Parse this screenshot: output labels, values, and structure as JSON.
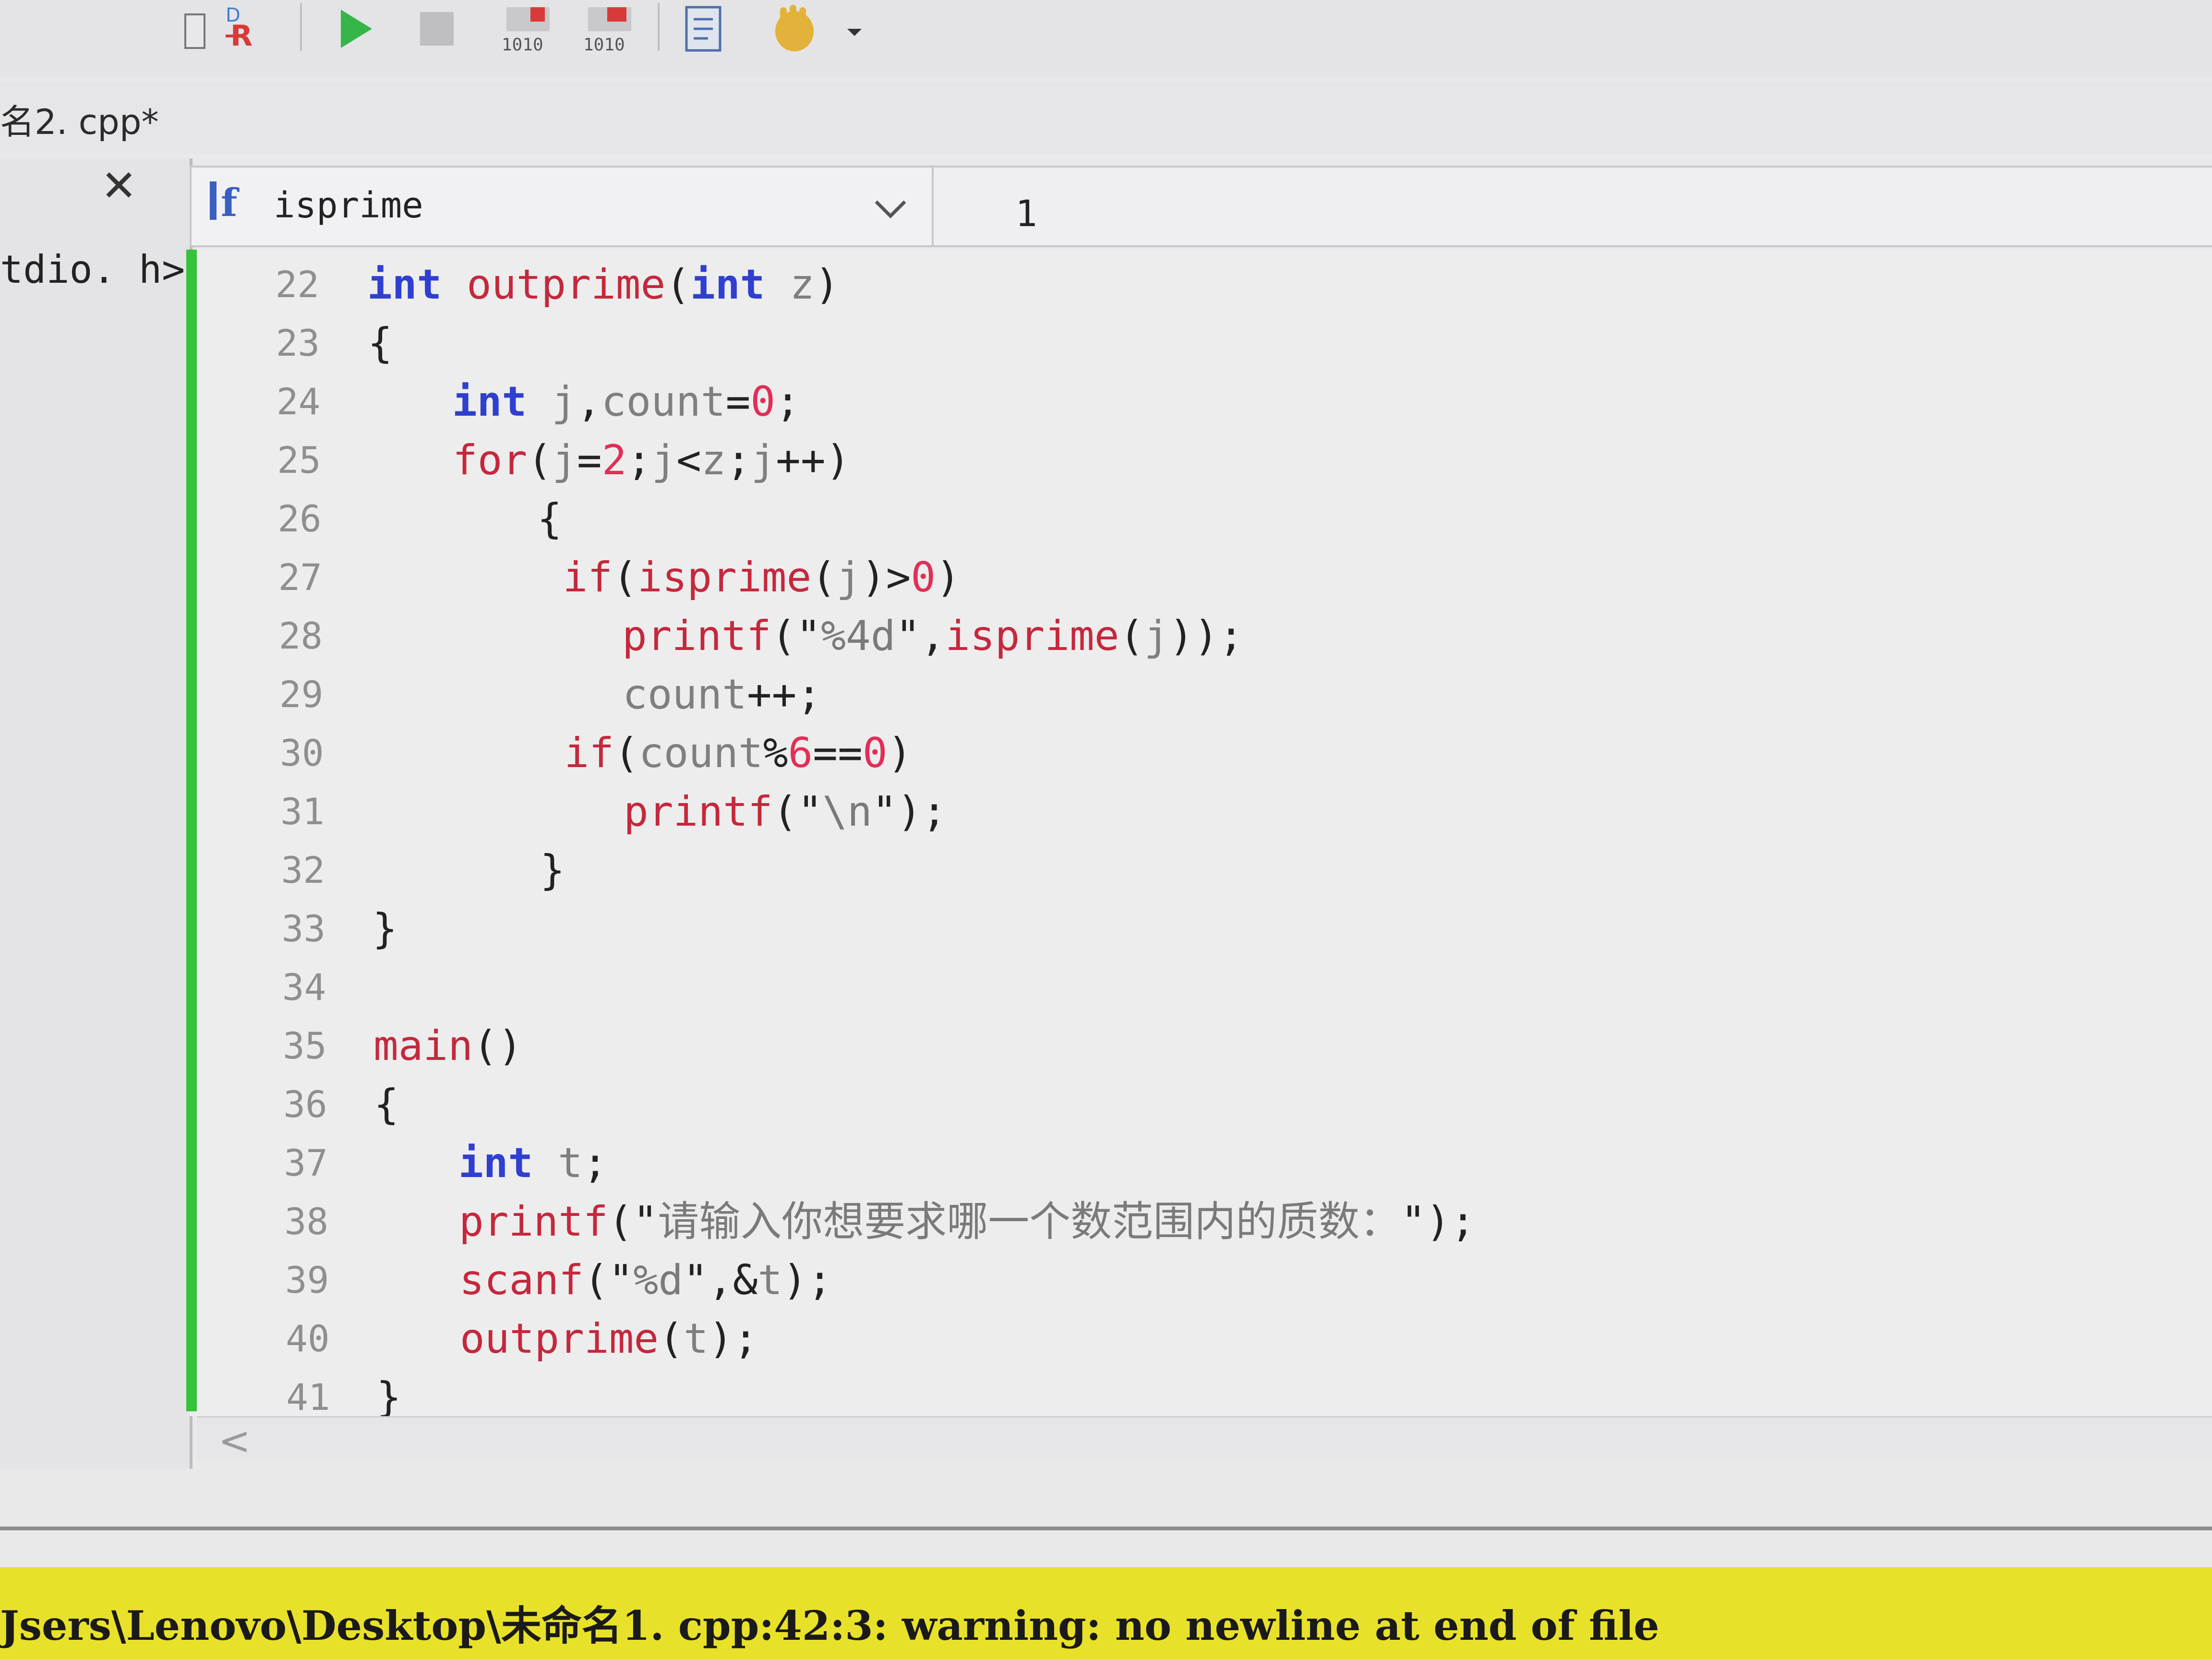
{
  "colors": {
    "keyword": "#2f3fd0",
    "function": "#c4283c",
    "identifier": "#7f7f7f",
    "number": "#e02f56",
    "string": "#7a7a7a",
    "punct": "#222222",
    "change_bar": "#36c23a",
    "error_highlight": "#e8e12a"
  },
  "toolbar": {
    "icons": [
      "compile-icon",
      "rebuild-icon",
      "run-icon",
      "stop-icon",
      "debug-icon",
      "debug-step-icon",
      "profile-icon",
      "hand-icon",
      "dropdown-arrow-icon"
    ]
  },
  "tab": {
    "label": "名2. cpp*"
  },
  "left_pane": {
    "close": "✕",
    "item": "tdio. h>"
  },
  "function_select": {
    "value": "isprime"
  },
  "line_indicator": "1",
  "code": [
    {
      "n": "22",
      "indent": 0,
      "tokens": [
        [
          "kw",
          "int"
        ],
        [
          "pn",
          " "
        ],
        [
          "fn",
          "outprime"
        ],
        [
          "pn",
          "("
        ],
        [
          "kw",
          "int"
        ],
        [
          "pn",
          " "
        ],
        [
          "id",
          "z"
        ],
        [
          "pn",
          ")"
        ]
      ]
    },
    {
      "n": "23",
      "indent": 0,
      "tokens": [
        [
          "pn",
          "{"
        ]
      ]
    },
    {
      "n": "24",
      "indent": 1,
      "tokens": [
        [
          "kw",
          "int"
        ],
        [
          "pn",
          " "
        ],
        [
          "id",
          "j"
        ],
        [
          "pn",
          ","
        ],
        [
          "id",
          "count"
        ],
        [
          "pn",
          "="
        ],
        [
          "num",
          "0"
        ],
        [
          "pn",
          ";"
        ]
      ]
    },
    {
      "n": "25",
      "indent": 1,
      "tokens": [
        [
          "fn",
          "for"
        ],
        [
          "pn",
          "("
        ],
        [
          "id",
          "j"
        ],
        [
          "pn",
          "="
        ],
        [
          "num",
          "2"
        ],
        [
          "pn",
          ";"
        ],
        [
          "id",
          "j"
        ],
        [
          "pn",
          "<"
        ],
        [
          "id",
          "z"
        ],
        [
          "pn",
          ";"
        ],
        [
          "id",
          "j"
        ],
        [
          "pn",
          "++)"
        ]
      ]
    },
    {
      "n": "26",
      "indent": 2,
      "tokens": [
        [
          "pn",
          "{"
        ]
      ]
    },
    {
      "n": "27",
      "indent": 2.3,
      "tokens": [
        [
          "fn",
          "if"
        ],
        [
          "pn",
          "("
        ],
        [
          "fn",
          "isprime"
        ],
        [
          "pn",
          "("
        ],
        [
          "id",
          "j"
        ],
        [
          "pn",
          ")>"
        ],
        [
          "num",
          "0"
        ],
        [
          "pn",
          ")"
        ]
      ]
    },
    {
      "n": "28",
      "indent": 3,
      "tokens": [
        [
          "fn",
          "printf"
        ],
        [
          "pn",
          "(\""
        ],
        [
          "str",
          "%4d"
        ],
        [
          "pn",
          "\","
        ],
        [
          "fn",
          "isprime"
        ],
        [
          "pn",
          "("
        ],
        [
          "id",
          "j"
        ],
        [
          "pn",
          "));"
        ]
      ]
    },
    {
      "n": "29",
      "indent": 3,
      "tokens": [
        [
          "id",
          "count"
        ],
        [
          "pn",
          "++;"
        ]
      ]
    },
    {
      "n": "30",
      "indent": 2.3,
      "tokens": [
        [
          "fn",
          "if"
        ],
        [
          "pn",
          "("
        ],
        [
          "id",
          "count"
        ],
        [
          "pn",
          "%"
        ],
        [
          "num",
          "6"
        ],
        [
          "pn",
          "=="
        ],
        [
          "num",
          "0"
        ],
        [
          "pn",
          ")"
        ]
      ]
    },
    {
      "n": "31",
      "indent": 3,
      "tokens": [
        [
          "fn",
          "printf"
        ],
        [
          "pn",
          "(\""
        ],
        [
          "str",
          "\\n"
        ],
        [
          "pn",
          "\");"
        ]
      ]
    },
    {
      "n": "32",
      "indent": 2,
      "tokens": [
        [
          "pn",
          "}"
        ]
      ]
    },
    {
      "n": "33",
      "indent": 0,
      "tokens": [
        [
          "pn",
          "}"
        ]
      ]
    },
    {
      "n": "34",
      "indent": 0,
      "tokens": []
    },
    {
      "n": "35",
      "indent": 0,
      "tokens": [
        [
          "fn",
          "main"
        ],
        [
          "pn",
          "()"
        ]
      ]
    },
    {
      "n": "36",
      "indent": 0,
      "tokens": [
        [
          "pn",
          "{"
        ]
      ]
    },
    {
      "n": "37",
      "indent": 1,
      "tokens": [
        [
          "kw",
          "int"
        ],
        [
          "pn",
          " "
        ],
        [
          "id",
          "t"
        ],
        [
          "pn",
          ";"
        ]
      ]
    },
    {
      "n": "38",
      "indent": 1,
      "tokens": [
        [
          "fn",
          "printf"
        ],
        [
          "pn",
          "(\""
        ],
        [
          "str",
          "请输入你想要求哪一个数范围内的质数："
        ],
        [
          "pn",
          "\");"
        ]
      ]
    },
    {
      "n": "39",
      "indent": 1,
      "tokens": [
        [
          "fn",
          "scanf"
        ],
        [
          "pn",
          "(\""
        ],
        [
          "str",
          "%d"
        ],
        [
          "pn",
          "\",&"
        ],
        [
          "id",
          "t"
        ],
        [
          "pn",
          ");"
        ]
      ]
    },
    {
      "n": "40",
      "indent": 1,
      "tokens": [
        [
          "fn",
          "outprime"
        ],
        [
          "pn",
          "("
        ],
        [
          "id",
          "t"
        ],
        [
          "pn",
          ");"
        ]
      ]
    },
    {
      "n": "41",
      "indent": 0,
      "tokens": [
        [
          "pn",
          "}"
        ]
      ]
    }
  ],
  "hscroll": {
    "left_arrow": "<"
  },
  "log": {
    "line1": "Isers\\Lenovo\\Desktop\\未命名1. cpp...",
    "line2": "Jsers\\Lenovo\\Desktop\\未命名1. cpp:42:3:  warning:  no newline at end of file"
  }
}
